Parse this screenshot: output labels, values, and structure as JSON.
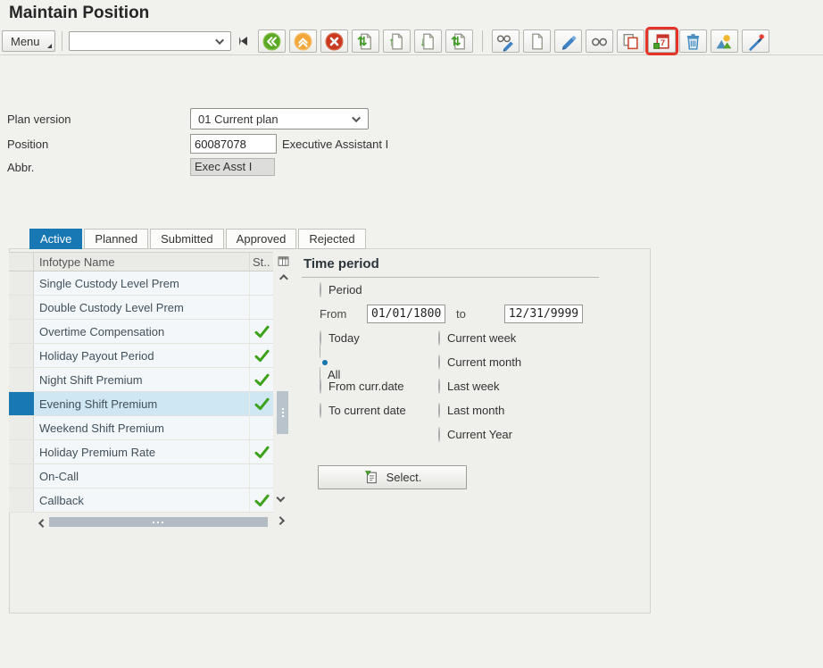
{
  "header": {
    "title": "Maintain Position"
  },
  "toolbar": {
    "menu_label": "Menu",
    "command_field": {
      "value": ""
    },
    "buttons": [
      {
        "icon": "back"
      },
      {
        "icon": "exit"
      },
      {
        "icon": "cancel"
      },
      {
        "icon": "first-page"
      },
      {
        "icon": "previous-page"
      },
      {
        "icon": "next-page"
      },
      {
        "icon": "last-page"
      },
      {
        "separator": true
      },
      {
        "icon": "display-change"
      },
      {
        "icon": "create"
      },
      {
        "icon": "change"
      },
      {
        "icon": "display"
      },
      {
        "icon": "copy"
      },
      {
        "icon": "delimit",
        "highlighted": true
      },
      {
        "icon": "delete"
      },
      {
        "icon": "overview"
      },
      {
        "icon": "wand"
      }
    ]
  },
  "form": {
    "plan_version": {
      "label": "Plan version",
      "value": "01 Current plan"
    },
    "position": {
      "label": "Position",
      "value": "60087078",
      "description": "Executive Assistant I"
    },
    "abbr": {
      "label": "Abbr.",
      "value": "Exec Asst I"
    }
  },
  "tabs": [
    {
      "label": "Active",
      "selected": true
    },
    {
      "label": "Planned",
      "selected": false
    },
    {
      "label": "Submitted",
      "selected": false
    },
    {
      "label": "Approved",
      "selected": false
    },
    {
      "label": "Rejected",
      "selected": false
    }
  ],
  "infotype_table": {
    "name_header": "Infotype Name",
    "status_header": "St..",
    "rows": [
      {
        "name": "Single Custody Level Prem",
        "checked": false,
        "selected": false
      },
      {
        "name": "Double Custody Level Prem",
        "checked": false,
        "selected": false
      },
      {
        "name": "Overtime Compensation",
        "checked": true,
        "selected": false
      },
      {
        "name": "Holiday Payout Period",
        "checked": true,
        "selected": false
      },
      {
        "name": "Night Shift Premium",
        "checked": true,
        "selected": false
      },
      {
        "name": "Evening Shift Premium",
        "checked": true,
        "selected": true
      },
      {
        "name": "Weekend Shift Premium",
        "checked": false,
        "selected": false
      },
      {
        "name": "Holiday Premium Rate",
        "checked": true,
        "selected": false
      },
      {
        "name": "On-Call",
        "checked": false,
        "selected": false
      },
      {
        "name": "Callback",
        "checked": true,
        "selected": false
      }
    ]
  },
  "time_period": {
    "title": "Time period",
    "period_option": {
      "label": "Period",
      "selected": false
    },
    "from_label": "From",
    "from_value": "01/01/1800",
    "to_label": "to",
    "to_value": "12/31/9999",
    "left_options": [
      {
        "label": "Today",
        "selected": false
      },
      {
        "label": "All",
        "selected": true
      },
      {
        "label": "From curr.date",
        "selected": false
      },
      {
        "label": "To current date",
        "selected": false
      }
    ],
    "right_options": [
      {
        "label": "Current week",
        "selected": false
      },
      {
        "label": "Current month",
        "selected": false
      },
      {
        "label": "Last week",
        "selected": false
      },
      {
        "label": "Last month",
        "selected": false
      },
      {
        "label": "Current Year",
        "selected": false
      }
    ],
    "select_button_label": "Select."
  },
  "colors": {
    "accent_blue": "#1878b3",
    "selected_row_bg": "#cfe6f3",
    "check_green": "#3da21b",
    "highlight_red": "#e6332a"
  }
}
